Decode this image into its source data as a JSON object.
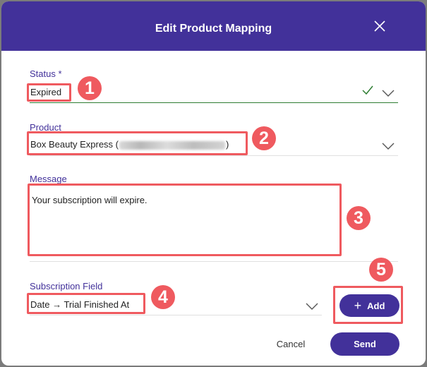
{
  "modal": {
    "title": "Edit Product Mapping"
  },
  "fields": {
    "status": {
      "label": "Status *",
      "value": "Expired"
    },
    "product": {
      "label": "Product",
      "value_prefix": "Box Beauty Express (",
      "value_suffix": ")"
    },
    "message": {
      "label": "Message",
      "value": "Your subscription will expire."
    },
    "subscription_field": {
      "label": "Subscription Field",
      "value": "Date → Trial Finished At"
    }
  },
  "buttons": {
    "add": {
      "icon": "plus-icon",
      "label": "Add"
    },
    "cancel": "Cancel",
    "send": "Send"
  },
  "annotations": [
    "1",
    "2",
    "3",
    "4",
    "5"
  ],
  "colors": {
    "primary": "#42319a",
    "annotation": "#ef5a5f",
    "valid": "#2e7d32"
  }
}
